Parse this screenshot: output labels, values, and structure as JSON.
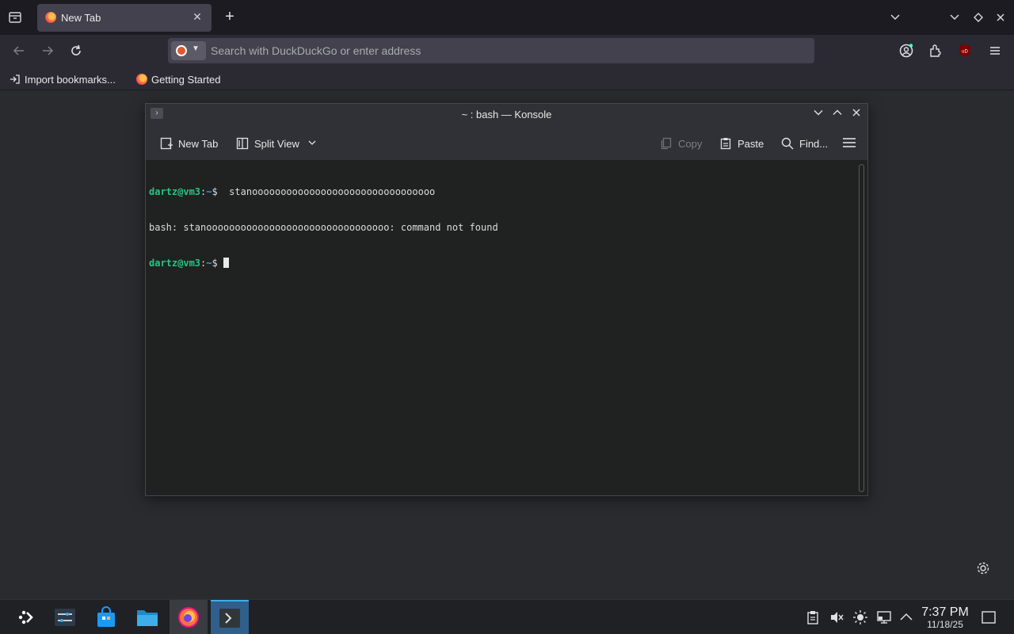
{
  "browser": {
    "tab_title": "New Tab",
    "url_placeholder": "Search with DuckDuckGo or enter address",
    "bookmarks": [
      {
        "label": "Import bookmarks..."
      },
      {
        "label": "Getting Started"
      }
    ]
  },
  "konsole": {
    "title": "~ : bash — Konsole",
    "toolbar": {
      "new_tab": "New Tab",
      "split_view": "Split View",
      "copy": "Copy",
      "paste": "Paste",
      "find": "Find..."
    },
    "terminal": {
      "lines": [
        {
          "user": "dartz@vm3",
          "sep": ":",
          "path": "~",
          "end": "$",
          "cmd": "  stanoooooooooooooooooooooooooooooooo"
        },
        {
          "text": "bash: stanoooooooooooooooooooooooooooooooo: command not found"
        },
        {
          "user": "dartz@vm3",
          "sep": ":",
          "path": "~",
          "end": "$",
          "cmd": " "
        }
      ]
    }
  },
  "taskbar": {
    "clock_time": "7:37 PM",
    "clock_date": "11/18/25"
  },
  "colors": {
    "prompt_user": "#27c486",
    "prompt_path": "#3d9de8",
    "terminal_bg": "#1f2220",
    "accent": "#3daee9"
  }
}
